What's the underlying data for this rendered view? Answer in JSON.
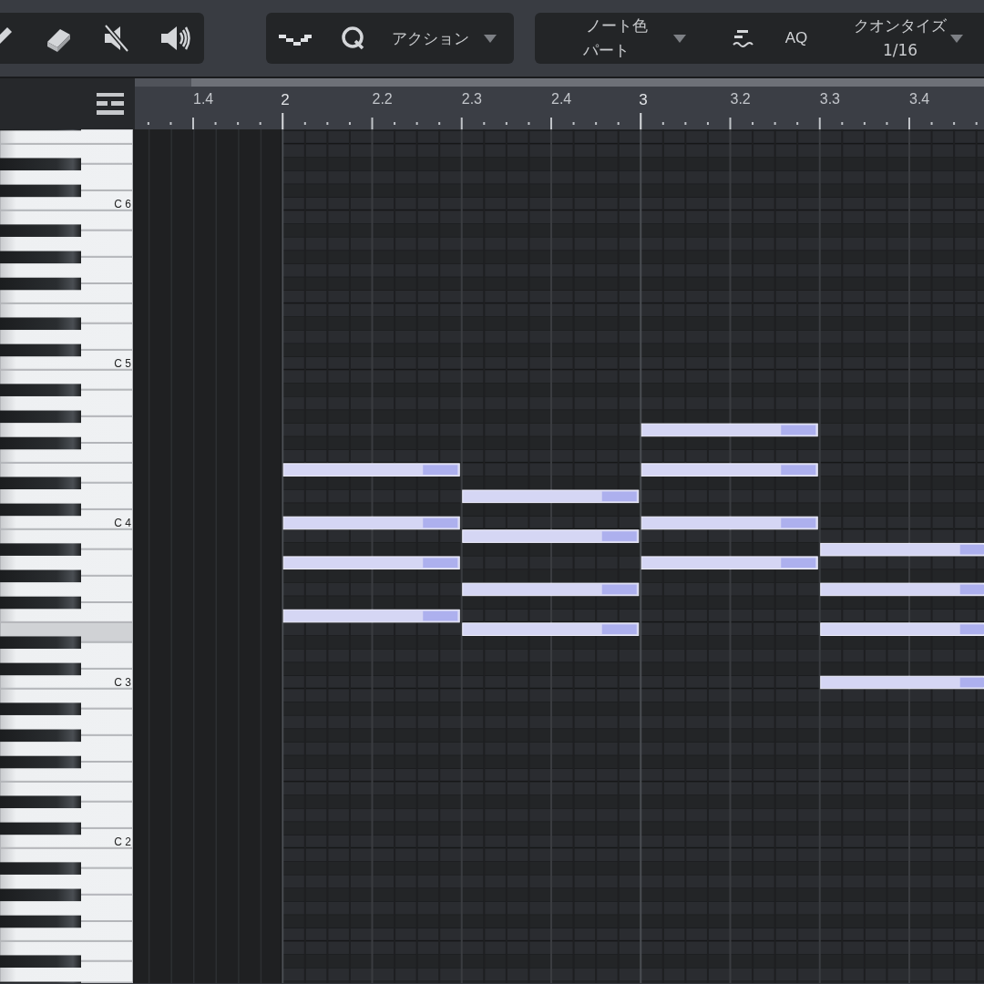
{
  "toolbar": {
    "action_menu": {
      "label": "アクション"
    },
    "note_color": {
      "label": "ノート色",
      "value": "パート"
    },
    "auto_quantize": {
      "label": "AQ"
    },
    "quantize": {
      "label": "クオンタイズ",
      "value": "1/16"
    }
  },
  "ruler": {
    "marks": [
      "1.4",
      "2",
      "2.2",
      "2.3",
      "2.4",
      "3",
      "3.2",
      "3.3",
      "3.4"
    ]
  },
  "keyboard": {
    "octave_labels": [
      "C 6",
      "C 5",
      "C 4",
      "C 3",
      "C 2"
    ]
  },
  "note_rows": [
    {
      "key_highlighted": false,
      "notes": [
        false,
        false,
        false,
        false
      ]
    },
    {
      "key_highlighted": false,
      "notes": [
        false,
        false,
        false,
        false
      ]
    },
    {
      "key_highlighted": false,
      "notes": [
        false,
        false,
        false,
        false
      ]
    },
    {
      "key_highlighted": false,
      "notes": [
        false,
        false,
        false,
        false
      ]
    },
    {
      "key_highlighted": false,
      "notes": [
        false,
        false,
        false,
        false
      ]
    },
    {
      "key_highlighted": false,
      "notes": [
        false,
        false,
        false,
        false
      ]
    },
    {
      "key_highlighted": false,
      "notes": [
        false,
        false,
        false,
        false
      ]
    },
    {
      "key_highlighted": false,
      "notes": [
        false,
        false,
        false,
        false
      ]
    },
    {
      "key_highlighted": false,
      "notes": [
        false,
        false,
        false,
        false
      ]
    },
    {
      "key_highlighted": false,
      "notes": [
        false,
        false,
        false,
        false
      ]
    },
    {
      "key_highlighted": false,
      "notes": [
        false,
        false,
        false,
        false
      ]
    },
    {
      "key_highlighted": false,
      "notes": [
        false,
        false,
        false,
        false
      ]
    },
    {
      "key_highlighted": false,
      "notes": [
        false,
        false,
        false,
        false
      ]
    },
    {
      "key_highlighted": false,
      "notes": [
        false,
        false,
        false,
        false
      ]
    },
    {
      "key_highlighted": false,
      "notes": [
        false,
        false,
        false,
        false
      ]
    },
    {
      "key_highlighted": false,
      "notes": [
        false,
        false,
        false,
        false
      ]
    },
    {
      "key_highlighted": false,
      "notes": [
        false,
        false,
        false,
        false
      ]
    },
    {
      "key_highlighted": false,
      "notes": [
        false,
        false,
        false,
        false
      ]
    },
    {
      "key_highlighted": false,
      "notes": [
        false,
        false,
        false,
        false
      ]
    },
    {
      "key_highlighted": false,
      "notes": [
        false,
        false,
        false,
        false
      ]
    },
    {
      "key_highlighted": false,
      "notes": [
        false,
        false,
        false,
        false
      ]
    },
    {
      "key_highlighted": false,
      "notes": [
        false,
        false,
        false,
        false
      ]
    },
    {
      "key_highlighted": false,
      "notes": [
        false,
        false,
        true,
        false
      ]
    },
    {
      "key_highlighted": false,
      "notes": [
        false,
        false,
        false,
        false
      ]
    },
    {
      "key_highlighted": false,
      "notes": [
        false,
        false,
        false,
        false
      ]
    },
    {
      "key_highlighted": false,
      "notes": [
        true,
        false,
        true,
        false
      ]
    },
    {
      "key_highlighted": false,
      "notes": [
        false,
        false,
        false,
        false
      ]
    },
    {
      "key_highlighted": false,
      "notes": [
        false,
        true,
        false,
        false
      ]
    },
    {
      "key_highlighted": false,
      "notes": [
        false,
        false,
        false,
        false
      ]
    },
    {
      "key_highlighted": false,
      "notes": [
        true,
        false,
        true,
        false
      ]
    },
    {
      "key_highlighted": false,
      "notes": [
        false,
        true,
        false,
        false
      ]
    },
    {
      "key_highlighted": false,
      "notes": [
        false,
        false,
        false,
        true
      ]
    },
    {
      "key_highlighted": false,
      "notes": [
        true,
        false,
        true,
        false
      ]
    },
    {
      "key_highlighted": false,
      "notes": [
        false,
        false,
        false,
        false
      ]
    },
    {
      "key_highlighted": false,
      "notes": [
        false,
        true,
        false,
        true
      ]
    },
    {
      "key_highlighted": false,
      "notes": [
        false,
        false,
        false,
        false
      ]
    },
    {
      "key_highlighted": false,
      "notes": [
        true,
        false,
        false,
        false
      ]
    },
    {
      "key_highlighted": true,
      "notes": [
        false,
        true,
        false,
        true
      ]
    },
    {
      "key_highlighted": false,
      "notes": [
        false,
        false,
        false,
        false
      ]
    },
    {
      "key_highlighted": false,
      "notes": [
        false,
        false,
        false,
        false
      ]
    },
    {
      "key_highlighted": false,
      "notes": [
        false,
        false,
        false,
        false
      ]
    },
    {
      "key_highlighted": false,
      "notes": [
        false,
        false,
        false,
        true
      ]
    }
  ]
}
